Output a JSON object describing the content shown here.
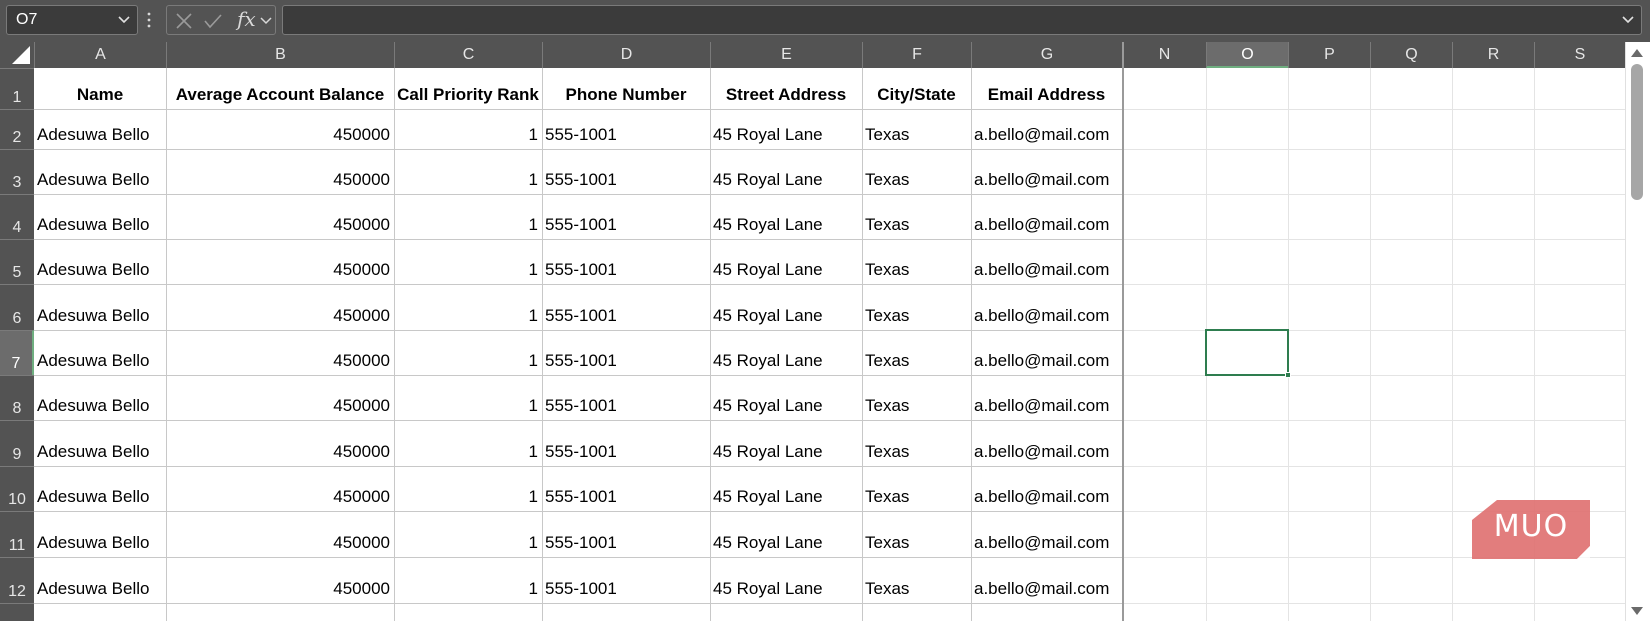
{
  "formula_bar": {
    "name_box": "O7",
    "formula": "",
    "fx_label": "fx"
  },
  "columns": [
    "A",
    "B",
    "C",
    "D",
    "E",
    "F",
    "G",
    "N",
    "O",
    "P",
    "Q",
    "R",
    "S"
  ],
  "selected_column": "O",
  "rows": [
    "1",
    "2",
    "3",
    "4",
    "5",
    "6",
    "7",
    "8",
    "9",
    "10",
    "11",
    "12"
  ],
  "selected_row": "7",
  "table": {
    "headers": [
      "Name",
      "Average Account Balance",
      "Call Priority Rank",
      "Phone Number",
      "Street Address",
      "City/State",
      "Email Address"
    ],
    "rows": [
      [
        "Adesuwa Bello",
        "450000",
        "1",
        "555-1001",
        "45 Royal Lane",
        "Texas",
        "a.bello@mail.com"
      ],
      [
        "Adesuwa Bello",
        "450000",
        "1",
        "555-1001",
        "45 Royal Lane",
        "Texas",
        "a.bello@mail.com"
      ],
      [
        "Adesuwa Bello",
        "450000",
        "1",
        "555-1001",
        "45 Royal Lane",
        "Texas",
        "a.bello@mail.com"
      ],
      [
        "Adesuwa Bello",
        "450000",
        "1",
        "555-1001",
        "45 Royal Lane",
        "Texas",
        "a.bello@mail.com"
      ],
      [
        "Adesuwa Bello",
        "450000",
        "1",
        "555-1001",
        "45 Royal Lane",
        "Texas",
        "a.bello@mail.com"
      ],
      [
        "Adesuwa Bello",
        "450000",
        "1",
        "555-1001",
        "45 Royal Lane",
        "Texas",
        "a.bello@mail.com"
      ],
      [
        "Adesuwa Bello",
        "450000",
        "1",
        "555-1001",
        "45 Royal Lane",
        "Texas",
        "a.bello@mail.com"
      ],
      [
        "Adesuwa Bello",
        "450000",
        "1",
        "555-1001",
        "45 Royal Lane",
        "Texas",
        "a.bello@mail.com"
      ],
      [
        "Adesuwa Bello",
        "450000",
        "1",
        "555-1001",
        "45 Royal Lane",
        "Texas",
        "a.bello@mail.com"
      ],
      [
        "Adesuwa Bello",
        "450000",
        "1",
        "555-1001",
        "45 Royal Lane",
        "Texas",
        "a.bello@mail.com"
      ],
      [
        "Adesuwa Bello",
        "450000",
        "1",
        "555-1001",
        "45 Royal Lane",
        "Texas",
        "a.bello@mail.com"
      ]
    ]
  },
  "watermark": {
    "text": "MUO",
    "color": "#e07272"
  },
  "colors": {
    "accent": "#2e7d4f",
    "chrome": "#535353"
  },
  "icons": {
    "name_box_dropdown": "chevron-down-icon",
    "cancel": "close-icon",
    "enter": "check-icon",
    "formula_expand": "chevron-down-icon"
  }
}
